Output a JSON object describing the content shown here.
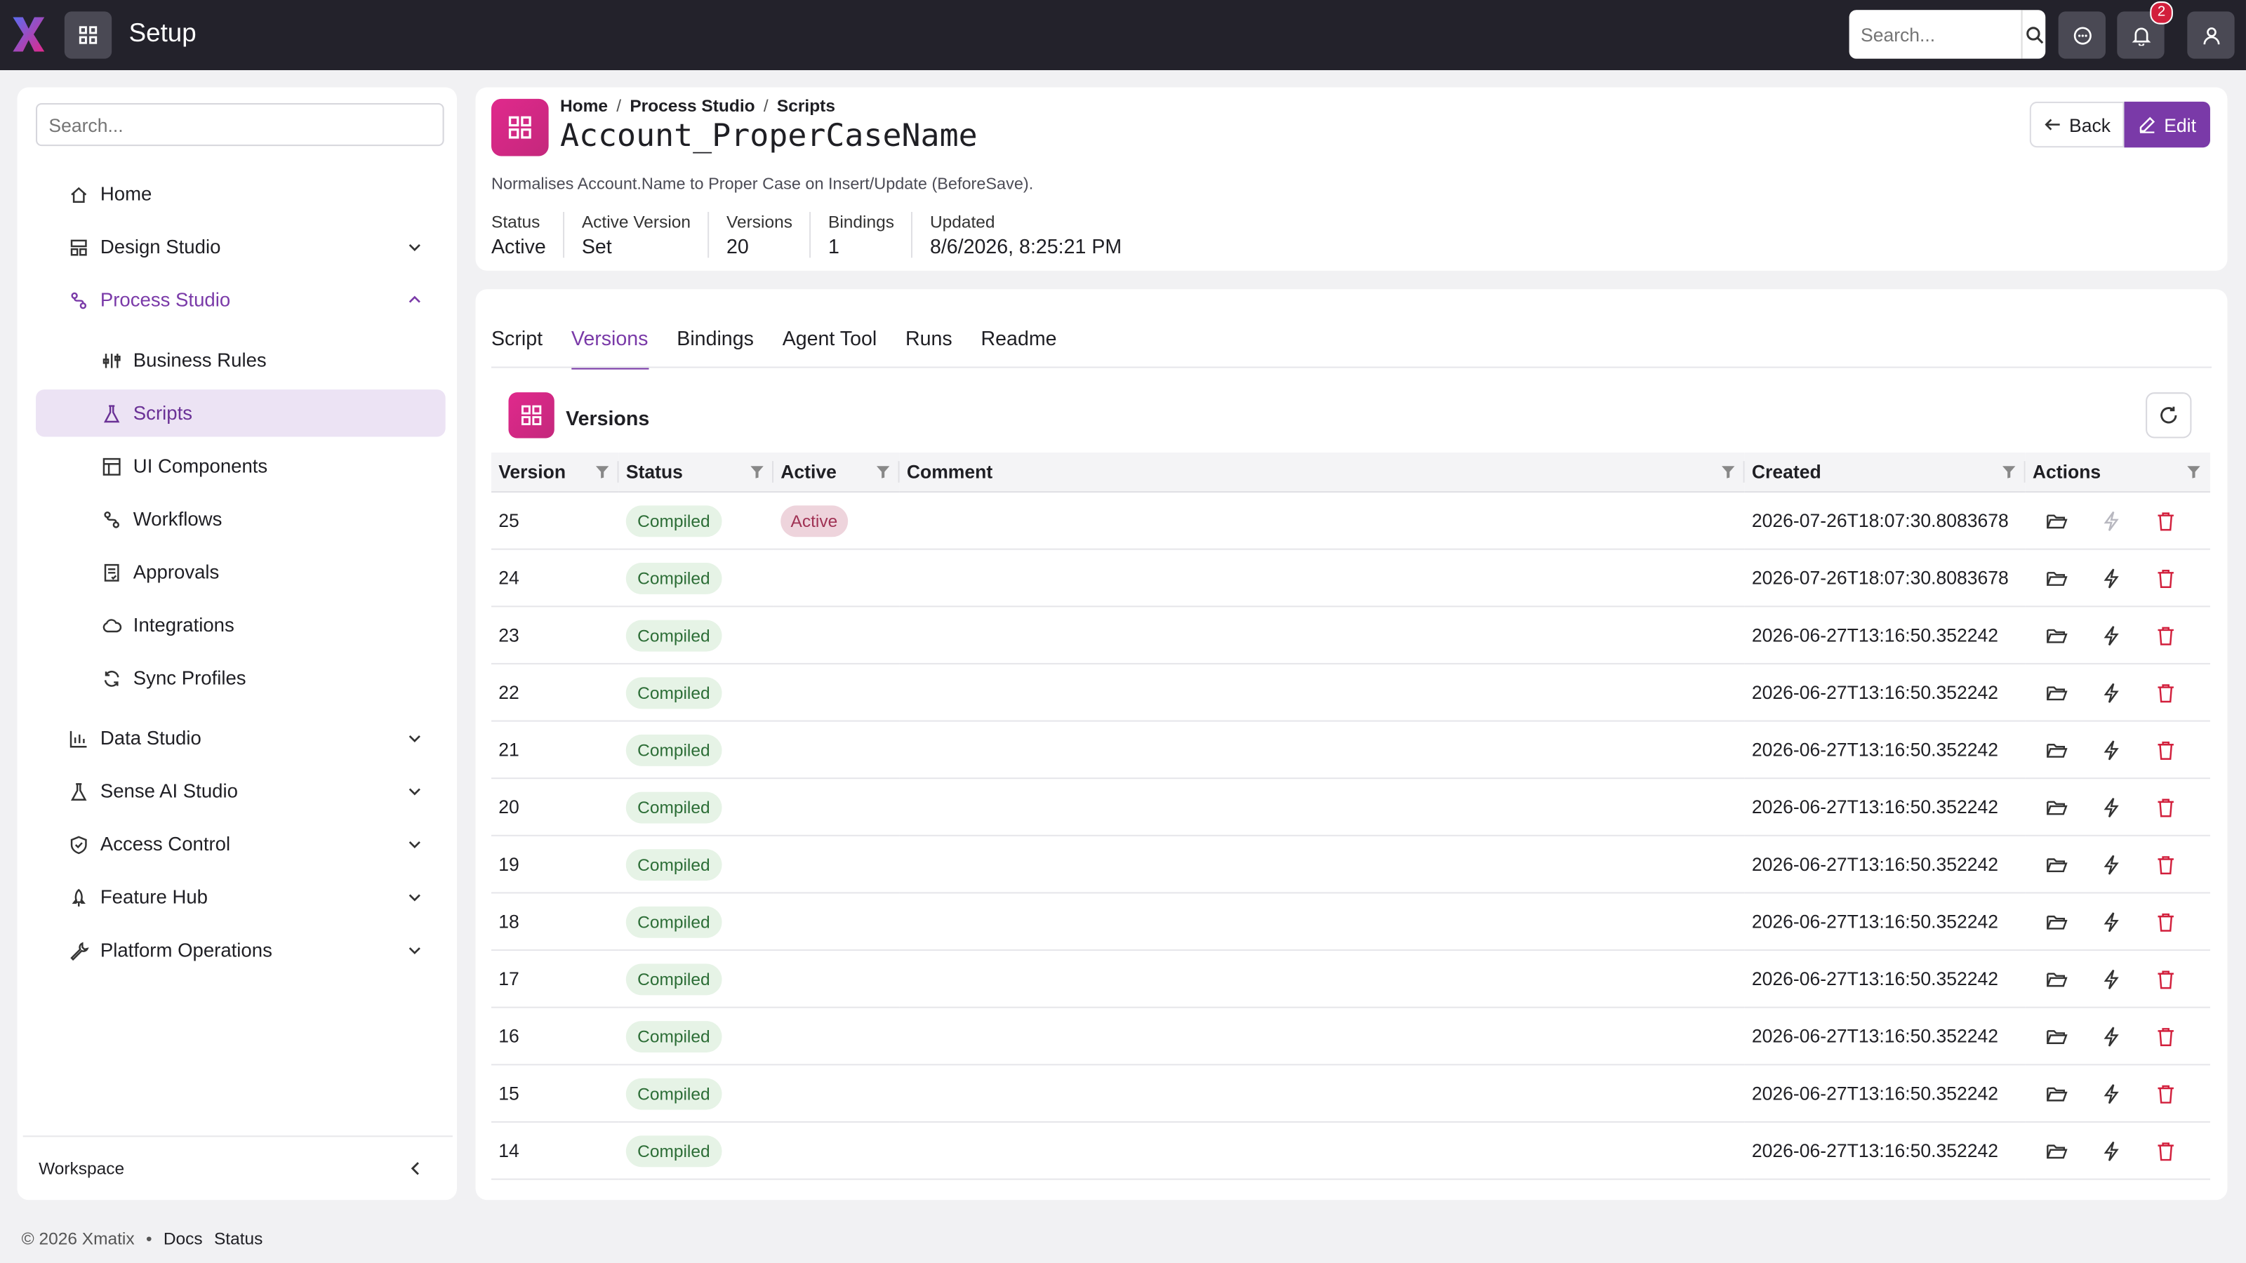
{
  "app": {
    "title": "Setup",
    "logo": "x-logo-icon"
  },
  "topbar": {
    "search_placeholder": "Search...",
    "notification_count": "2"
  },
  "sidebar": {
    "search_placeholder": "Search...",
    "items": [
      {
        "label": "Home",
        "icon": "home-icon",
        "level": 1
      },
      {
        "label": "Design Studio",
        "icon": "design-icon",
        "level": 1,
        "expandable": true
      },
      {
        "label": "Process Studio",
        "icon": "process-icon",
        "level": 1,
        "expandable": true,
        "open": true
      },
      {
        "label": "Business Rules",
        "icon": "rules-icon",
        "level": 2
      },
      {
        "label": "Scripts",
        "icon": "flask-icon",
        "level": 2,
        "selected": true
      },
      {
        "label": "UI Components",
        "icon": "layout-icon",
        "level": 2
      },
      {
        "label": "Workflows",
        "icon": "workflow-icon",
        "level": 2
      },
      {
        "label": "Approvals",
        "icon": "approvals-icon",
        "level": 2
      },
      {
        "label": "Integrations",
        "icon": "cloud-icon",
        "level": 2
      },
      {
        "label": "Sync Profiles",
        "icon": "sync-icon",
        "level": 2
      },
      {
        "label": "Data Studio",
        "icon": "chart-icon",
        "level": 1,
        "expandable": true
      },
      {
        "label": "Sense AI Studio",
        "icon": "flask-icon",
        "level": 1,
        "expandable": true
      },
      {
        "label": "Access Control",
        "icon": "shield-icon",
        "level": 1,
        "expandable": true
      },
      {
        "label": "Feature Hub",
        "icon": "rocket-icon",
        "level": 1,
        "expandable": true
      },
      {
        "label": "Platform Operations",
        "icon": "wrench-icon",
        "level": 1,
        "expandable": true
      }
    ],
    "footer_label": "Workspace"
  },
  "header": {
    "breadcrumb": [
      "Home",
      "Process Studio",
      "Scripts"
    ],
    "title": "Account_ProperCaseName",
    "description": "Normalises Account.Name to Proper Case on Insert/Update (BeforeSave).",
    "stats": [
      {
        "label": "Status",
        "value": "Active"
      },
      {
        "label": "Active Version",
        "value": "Set"
      },
      {
        "label": "Versions",
        "value": "20"
      },
      {
        "label": "Bindings",
        "value": "1"
      },
      {
        "label": "Updated",
        "value": "8/6/2026, 8:25:21 PM"
      }
    ],
    "back_label": "Back",
    "edit_label": "Edit"
  },
  "tabs": [
    "Script",
    "Versions",
    "Bindings",
    "Agent Tool",
    "Runs",
    "Readme"
  ],
  "active_tab": "Versions",
  "versions": {
    "title": "Versions",
    "columns": [
      "Version",
      "Status",
      "Active",
      "Comment",
      "Created",
      "Actions"
    ],
    "rows": [
      {
        "version": "25",
        "status": "Compiled",
        "active": "Active",
        "comment": "",
        "created": "2026-07-26T18:07:30.8083678"
      },
      {
        "version": "24",
        "status": "Compiled",
        "active": "",
        "comment": "",
        "created": "2026-07-26T18:07:30.8083678"
      },
      {
        "version": "23",
        "status": "Compiled",
        "active": "",
        "comment": "",
        "created": "2026-06-27T13:16:50.352242"
      },
      {
        "version": "22",
        "status": "Compiled",
        "active": "",
        "comment": "",
        "created": "2026-06-27T13:16:50.352242"
      },
      {
        "version": "21",
        "status": "Compiled",
        "active": "",
        "comment": "",
        "created": "2026-06-27T13:16:50.352242"
      },
      {
        "version": "20",
        "status": "Compiled",
        "active": "",
        "comment": "",
        "created": "2026-06-27T13:16:50.352242"
      },
      {
        "version": "19",
        "status": "Compiled",
        "active": "",
        "comment": "",
        "created": "2026-06-27T13:16:50.352242"
      },
      {
        "version": "18",
        "status": "Compiled",
        "active": "",
        "comment": "",
        "created": "2026-06-27T13:16:50.352242"
      },
      {
        "version": "17",
        "status": "Compiled",
        "active": "",
        "comment": "",
        "created": "2026-06-27T13:16:50.352242"
      },
      {
        "version": "16",
        "status": "Compiled",
        "active": "",
        "comment": "",
        "created": "2026-06-27T13:16:50.352242"
      },
      {
        "version": "15",
        "status": "Compiled",
        "active": "",
        "comment": "",
        "created": "2026-06-27T13:16:50.352242"
      },
      {
        "version": "14",
        "status": "Compiled",
        "active": "",
        "comment": "",
        "created": "2026-06-27T13:16:50.352242"
      }
    ]
  },
  "footer": {
    "copyright": "© 2026 Xmatix",
    "bullet": "•",
    "links": [
      "Docs",
      "Status"
    ]
  },
  "colors": {
    "accent": "#7a3aa8",
    "brand_pink": "#e0298c",
    "topbar": "#23222b",
    "danger": "#d21f3c"
  }
}
